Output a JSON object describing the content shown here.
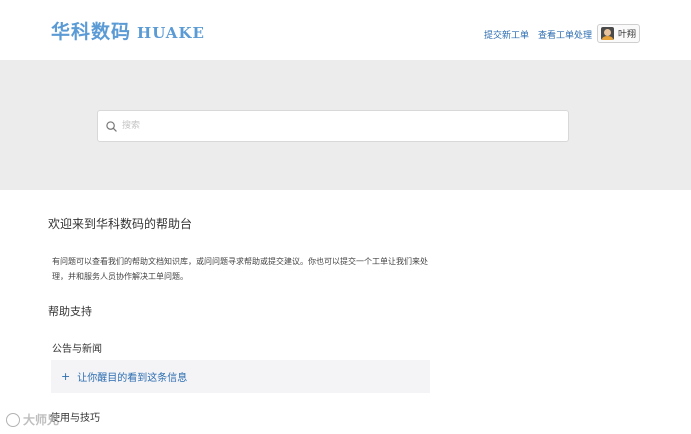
{
  "header": {
    "logo_cn": "华科数码",
    "logo_en": "HUAKE",
    "nav": {
      "new_ticket": "提交新工单",
      "view_tickets": "查看工单处理"
    },
    "user": {
      "name": "叶翔"
    }
  },
  "search": {
    "placeholder": "搜索"
  },
  "main": {
    "welcome": "欢迎来到华科数码的帮助台",
    "description": "有问题可以查看我们的帮助文档知识库，或问问题寻求帮助或提交建议。你也可以提交一个工单让我们来处理，并和服务人员协作解决工单问题。",
    "help_title": "帮助支持",
    "news_title": "公告与新闻",
    "news_item": "让你醒目的看到这条信息",
    "tips_title": "使用与技巧"
  },
  "watermark": {
    "text": "大师兄"
  },
  "colors": {
    "brand": "#5b9bd5",
    "link": "#2b6cb0",
    "hero_bg": "#ececec"
  }
}
